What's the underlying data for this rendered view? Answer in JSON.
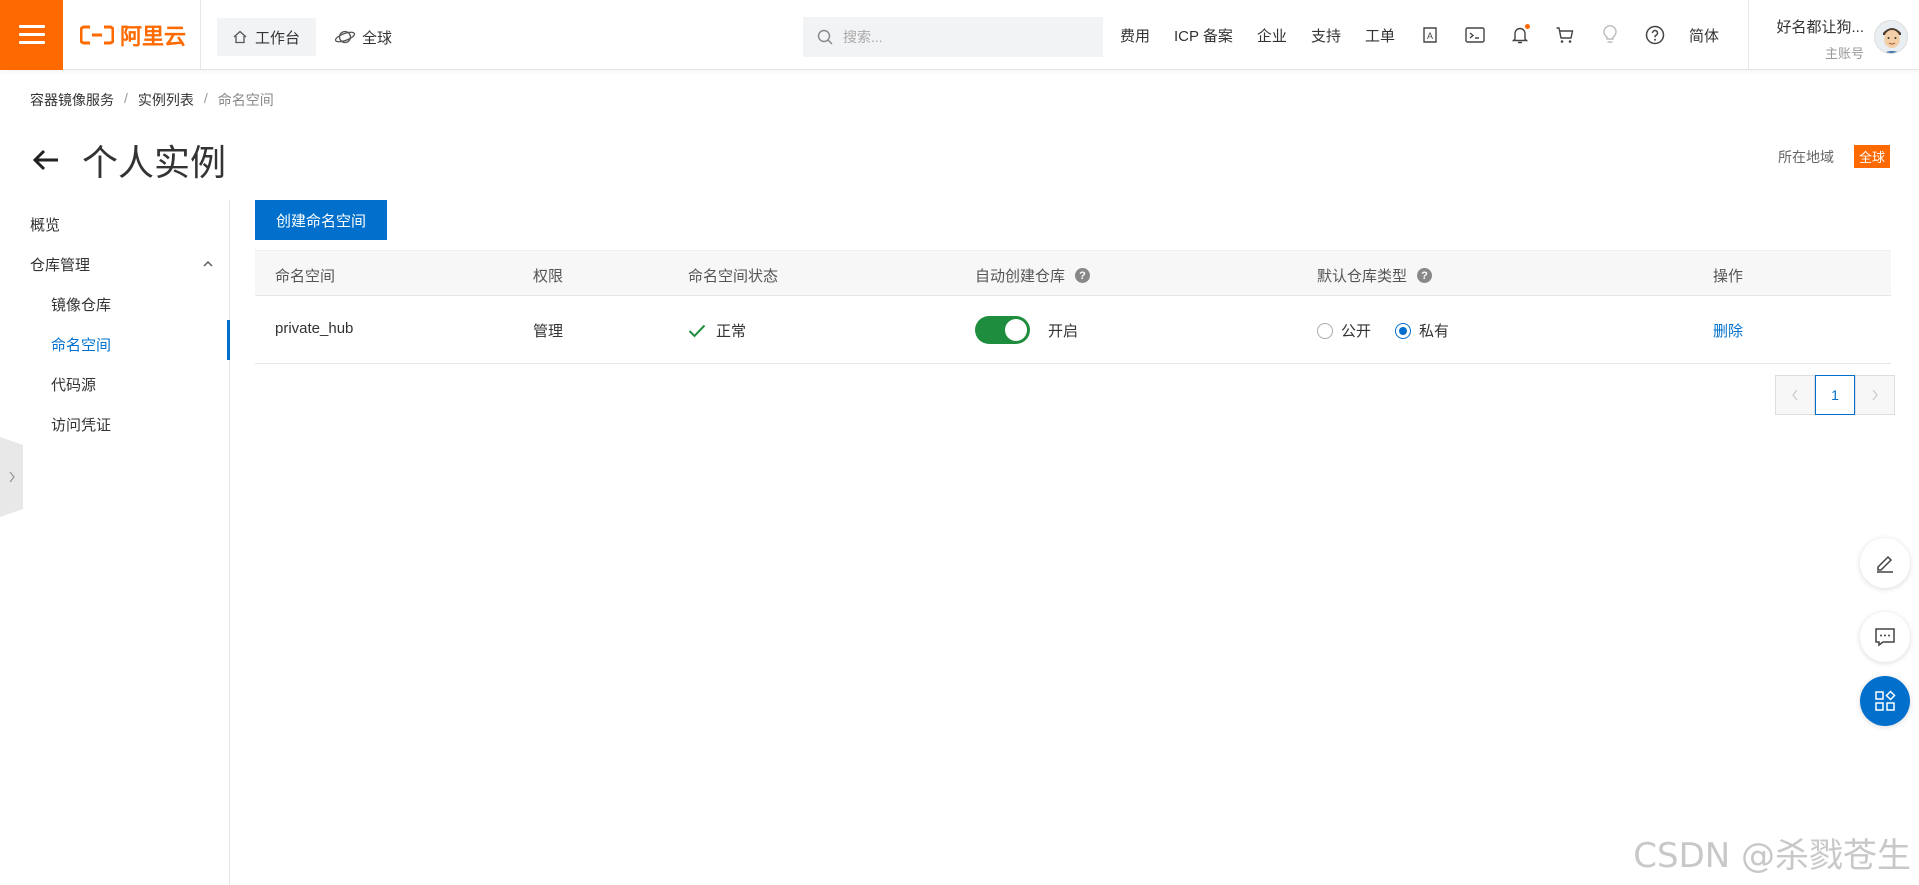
{
  "topbar": {
    "logo_text": "阿里云",
    "workbench_label": "工作台",
    "global_label": "全球",
    "search_placeholder": "搜索...",
    "links": [
      "费用",
      "ICP 备案",
      "企业",
      "支持",
      "工单"
    ],
    "language_label": "简体",
    "user_name": "好名都让狗...",
    "user_role": "主账号",
    "accent_color": "#ff6a00"
  },
  "breadcrumb": {
    "items": [
      "容器镜像服务",
      "实例列表",
      "命名空间"
    ]
  },
  "page": {
    "title": "个人实例",
    "region_label": "所在地域",
    "region_value": "全球"
  },
  "sidebar": {
    "items": [
      {
        "label": "概览"
      },
      {
        "label": "仓库管理"
      },
      {
        "label": "镜像仓库"
      },
      {
        "label": "命名空间"
      },
      {
        "label": "代码源"
      },
      {
        "label": "访问凭证"
      }
    ],
    "active_label": "命名空间"
  },
  "main": {
    "create_button": "创建命名空间",
    "columns": [
      "命名空间",
      "权限",
      "命名空间状态",
      "自动创建仓库",
      "默认仓库类型",
      "操作"
    ],
    "rows": [
      {
        "namespace": "private_hub",
        "permission": "管理",
        "status": "正常",
        "auto_create": "开启",
        "auto_create_on": true,
        "type_public": "公开",
        "type_private": "私有",
        "selected_type": "私有",
        "action": "删除"
      }
    ],
    "pagination": {
      "current_page": "1"
    }
  },
  "watermark": "CSDN @杀戮苍生",
  "colors": {
    "primary": "#0070cc",
    "success": "#1e8e3e",
    "brand": "#ff6a00"
  }
}
